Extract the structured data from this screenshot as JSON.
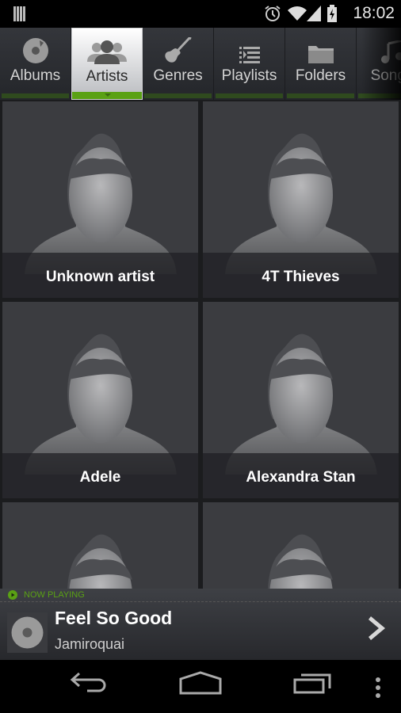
{
  "status_bar": {
    "time": "18:02",
    "icons": [
      "notification-icon",
      "alarm-icon",
      "wifi-icon",
      "signal-icon",
      "battery-charging-icon"
    ]
  },
  "tabs": [
    {
      "label": "Albums",
      "icon": "album-icon",
      "active": false
    },
    {
      "label": "Artists",
      "icon": "artists-icon",
      "active": true
    },
    {
      "label": "Genres",
      "icon": "guitar-icon",
      "active": false
    },
    {
      "label": "Playlists",
      "icon": "playlist-icon",
      "active": false
    },
    {
      "label": "Folders",
      "icon": "folder-icon",
      "active": false
    },
    {
      "label": "Songs",
      "icon": "music-note-icon",
      "active": false
    }
  ],
  "artists": [
    {
      "name": "Unknown artist"
    },
    {
      "name": "4T Thieves"
    },
    {
      "name": "Adele"
    },
    {
      "name": "Alexandra Stan"
    },
    {
      "name": ""
    },
    {
      "name": ""
    }
  ],
  "now_playing": {
    "header": "NOW PLAYING",
    "title": "Feel So Good",
    "artist": "Jamiroquai",
    "accent": "#5aa114"
  },
  "nav_bar": {
    "buttons": [
      "back",
      "home",
      "recent-apps",
      "menu"
    ]
  }
}
